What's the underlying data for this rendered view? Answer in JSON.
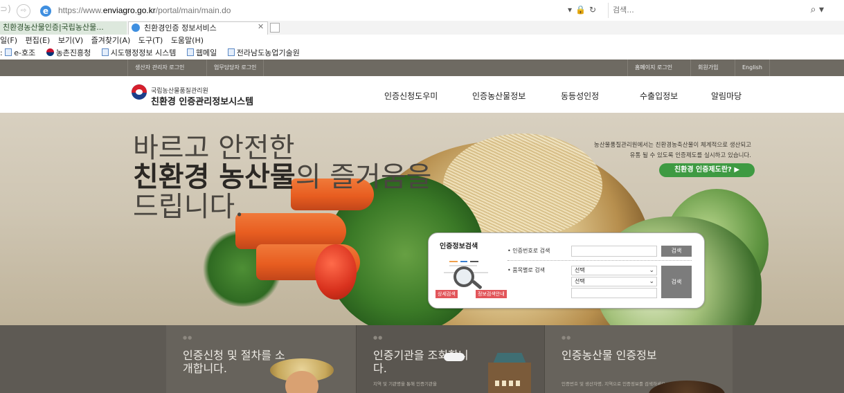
{
  "browser": {
    "url_prefix": "https://www.",
    "url_domain": "enviagro.go.kr",
    "url_path": "/portal/main/main.do",
    "search_placeholder": "검색...",
    "tabs": [
      {
        "label": "친환경농산물인증|국립농산물..."
      },
      {
        "label": "친환경인증 정보서비스"
      }
    ],
    "menu": [
      "일(F)",
      "편집(E)",
      "보기(V)",
      "즐겨찾기(A)",
      "도구(T)",
      "도움말(H)"
    ],
    "favorites": [
      "e-호조",
      "농촌진흥청",
      "시도행정정보 시스템",
      "웹메일",
      "전라남도농업기술원"
    ]
  },
  "topbar": {
    "producer_login": "생산자 관리자 로그인",
    "staff_login": "업무담당자 로그인",
    "home_login": "홈페이지 로그인",
    "join": "회원가입",
    "english": "English"
  },
  "header": {
    "org_name": "국립농산물품질관리원",
    "site_name": "친환경 인증관리정보시스템",
    "nav": [
      "인증신청도우미",
      "인증농산물정보",
      "동등성인정",
      "수출입정보",
      "알림마당"
    ]
  },
  "hero": {
    "line1": "바르고 안전한",
    "line2_bold": "친환경 농산물",
    "line2_rest": "의 즐거움을",
    "line3": "드립니다.",
    "desc1": "농산물품질관리원에서는 친환경농축산물이 체계적으로 생산되고",
    "desc2": "유통 될 수 있도록 인증제도를 실시하고 있습니다.",
    "cta": "친환경 인증제도란?"
  },
  "search_panel": {
    "title": "인증정보검색",
    "by_number_label": "인증번호로 검색",
    "by_item_label": "품목별로 검색",
    "search_btn": "검색",
    "select1": "선택",
    "select2": "선택",
    "detail_btn": "상세검색",
    "guide_btn": "정보검색안내"
  },
  "cards": [
    {
      "dots": "●●",
      "title": "인증신청 및 절차를 소개합니다.",
      "desc": ""
    },
    {
      "dots": "●●",
      "title": "인증기관을 조회합니다.",
      "desc": "지역 및 기관명을 통해 인증기관을"
    },
    {
      "dots": "●●",
      "title": "인증농산물 인증정보",
      "desc": "인증번호 및 생산자명, 지역으로 인증정보를 검색하세요"
    }
  ],
  "colors": {
    "topbar": "#6e6a62",
    "cta_green": "#3e9a42",
    "red_button": "#e2555a",
    "search_button": "#7c7c7c"
  }
}
